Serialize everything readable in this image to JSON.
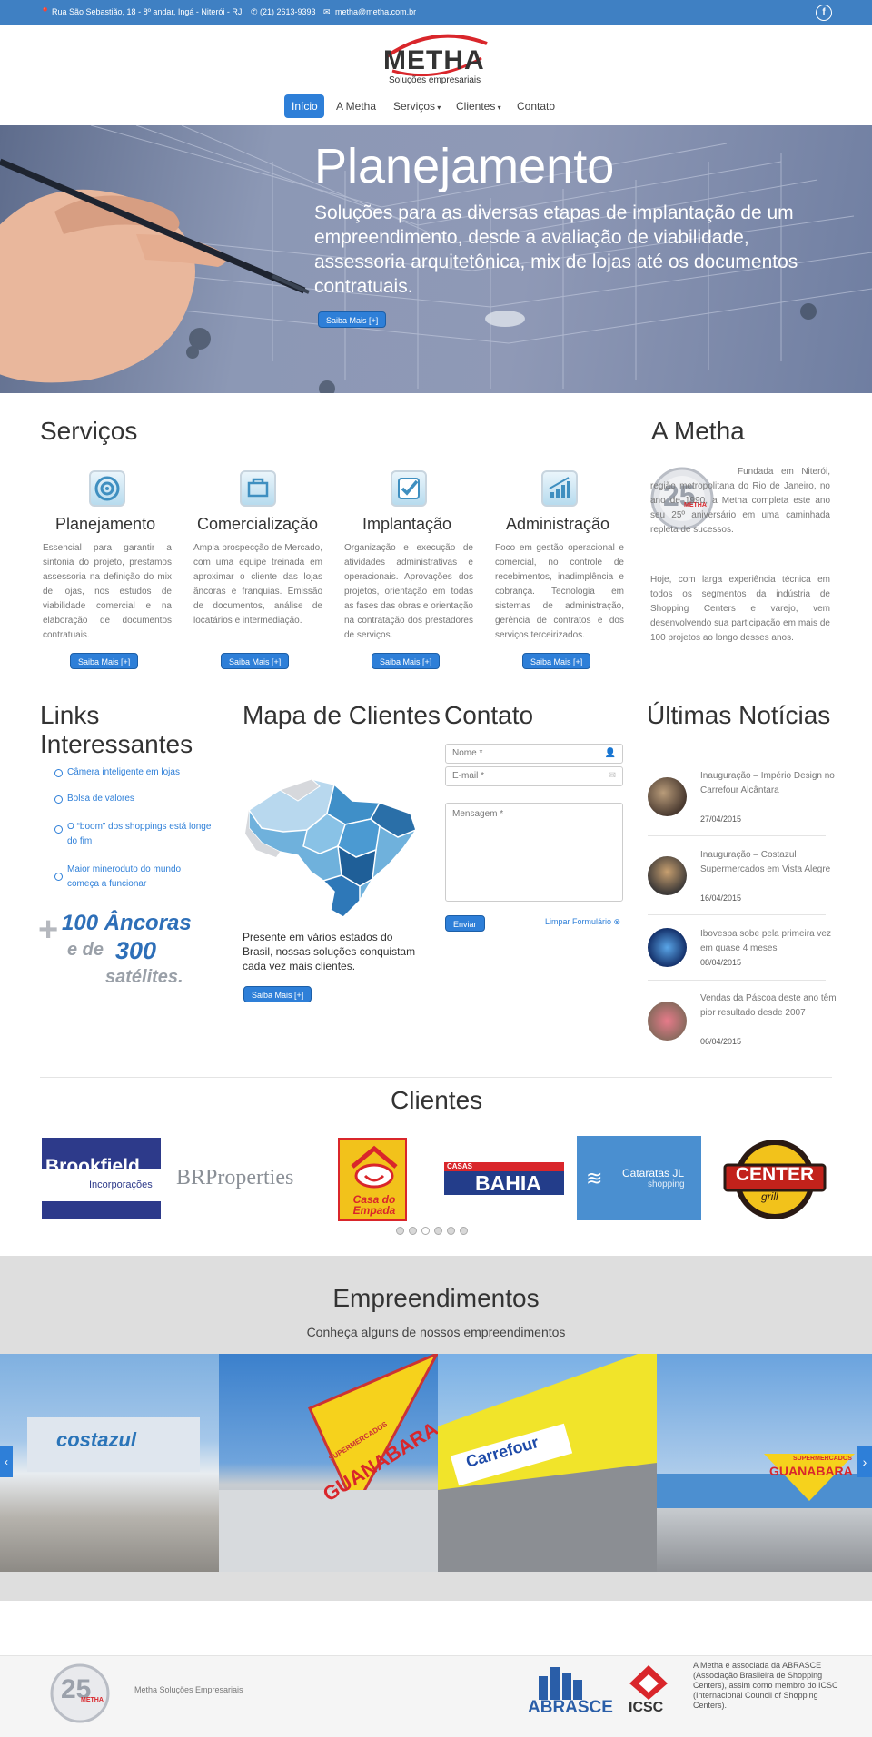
{
  "topbar": {
    "address": "Rua São Sebastião, 18 - 8º andar, Ingá - Niterói - RJ",
    "phone": "(21) 2613-9393",
    "email": "metha@metha.com.br",
    "social_icon": "facebook-icon"
  },
  "logo": {
    "name": "METHA",
    "tagline": "Soluções empresariais"
  },
  "nav": {
    "items": [
      {
        "label": "Início"
      },
      {
        "label": "A Metha"
      },
      {
        "label": "Serviços"
      },
      {
        "label": "Clientes"
      },
      {
        "label": "Contato"
      }
    ]
  },
  "hero": {
    "title": "Planejamento",
    "text": "Soluções para as diversas etapas de implantação de um empreendimento, desde a avaliação de viabilidade, assessoria arquitetônica, mix de lojas até os documentos contratuais.",
    "button": "Saiba Mais [+]"
  },
  "services": {
    "title": "Serviços",
    "items": [
      {
        "icon": "target-icon",
        "title": "Planejamento",
        "text": "Essencial para garantir a sintonia do projeto, prestamos assessoria na definição do mix de lojas, nos estudos de viabilidade comercial e na elaboração de documentos contratuais.",
        "button": "Saiba Mais [+]"
      },
      {
        "icon": "cart-icon",
        "title": "Comercialização",
        "text": "Ampla prospecção de Mercado, com uma equipe treinada em aproximar o cliente das lojas âncoras e franquias. Emissão de documentos, análise de locatários e intermediação.",
        "button": "Saiba Mais [+]"
      },
      {
        "icon": "checkmark-icon",
        "title": "Implantação",
        "text": "Organização e execução de atividades administrativas e operacionais. Aprovações dos projetos, orientação em todas as fases das obras e orientação na contratação dos prestadores de serviços.",
        "button": "Saiba Mais [+]"
      },
      {
        "icon": "growth-chart-icon",
        "title": "Administração",
        "text": "Foco em gestão operacional e comercial, no controle de recebimentos, inadimplência e cobrança. Tecnologia em sistemas de administração, gerência de contratos e dos serviços terceirizados.",
        "button": "Saiba Mais [+]"
      }
    ]
  },
  "about": {
    "title": "A Metha",
    "badge_number": "25",
    "badge_brand": "METHA",
    "paragraph1": "Fundada em Niterói, região metropolitana do Rio de Janeiro, no ano de 1990, a Metha completa este ano seu 25º aniversário em uma caminhada repleta de sucessos.",
    "paragraph2": "Hoje, com larga experiência técnica em todos os segmentos da indústria de Shopping Centers e varejo, vem desenvolvendo sua participação em mais de 100 projetos ao longo desses anos."
  },
  "links": {
    "title": "Links Interessantes",
    "items": [
      {
        "label": "Câmera inteligente em lojas"
      },
      {
        "label": "Bolsa de valores"
      },
      {
        "label": "O “boom” dos shoppings está longe do fim"
      },
      {
        "label": "Maior mineroduto do mundo começa a funcionar"
      }
    ],
    "promo": {
      "plus": "+",
      "line1": "100 Âncoras",
      "line2_prefix": "e de",
      "line2_number": "300",
      "line3": "satélites."
    }
  },
  "map": {
    "title": "Mapa de Clientes",
    "text": "Presente em vários estados do Brasil, nossas soluções conquistam cada vez mais clientes.",
    "button": "Saiba Mais [+]"
  },
  "contact": {
    "title": "Contato",
    "name_placeholder": "Nome *",
    "email_placeholder": "E-mail *",
    "message_placeholder": "Mensagem *",
    "send": "Enviar",
    "clear": "Limpar Formulário"
  },
  "news": {
    "title": "Últimas Notícias",
    "items": [
      {
        "title": "Inauguração – Império Design no Carrefour Alcântara",
        "date": "27/04/2015"
      },
      {
        "title": "Inauguração – Costazul Supermercados em Vista Alegre",
        "date": "16/04/2015"
      },
      {
        "title": "Ibovespa sobe pela primeira vez em quase 4 meses",
        "date": "08/04/2015"
      },
      {
        "title": "Vendas da Páscoa deste ano têm pior resultado desde 2007",
        "date": "06/04/2015"
      }
    ]
  },
  "clients": {
    "title": "Clientes",
    "logos": [
      {
        "name": "Brookfield",
        "sub": "Incorporações"
      },
      {
        "name": "BRProperties"
      },
      {
        "name": "Casa do Empada"
      },
      {
        "name": "BAHIA",
        "pre": "CASAS"
      },
      {
        "name": "Cataratas JL",
        "sub": "shopping"
      },
      {
        "name": "CENTER",
        "sub": "grill"
      }
    ]
  },
  "projects": {
    "title": "Empreendimentos",
    "subtitle": "Conheça alguns de nossos empreendimentos",
    "photos": [
      {
        "label": "costazul"
      },
      {
        "label": "GUANABARA",
        "pre": "SUPERMERCADOS"
      },
      {
        "label": "Carrefour"
      },
      {
        "label": "GUANABARA",
        "pre": "SUPERMERCADOS"
      }
    ]
  },
  "footer": {
    "company": "Metha Soluções Empresariais",
    "abrasce": "ABRASCE",
    "icsc": "ICSC",
    "note": "A Metha é associada da ABRASCE (Associação Brasileira de Shopping Centers), assim como membro do ICSC (Internacional Council of Shopping Centers)."
  }
}
